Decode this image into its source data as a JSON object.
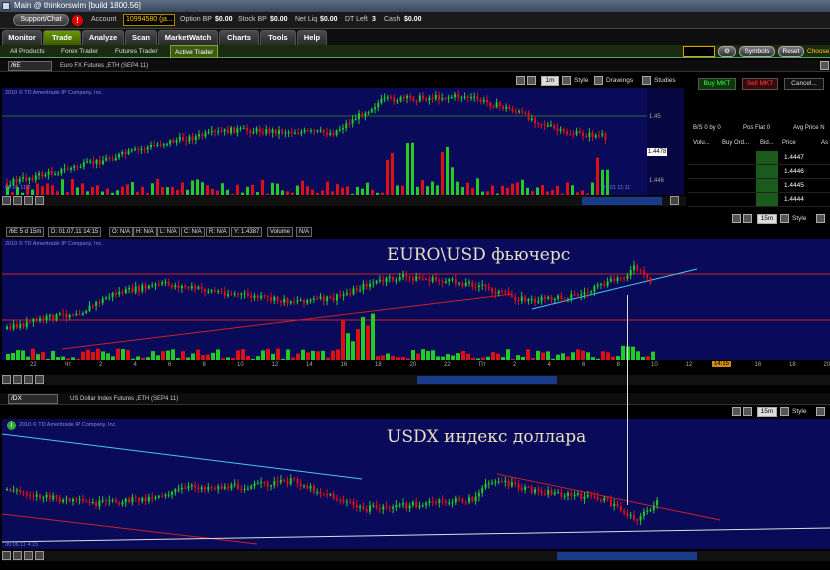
{
  "title_bar": {
    "title": "Main @ thinkorswim [build 1800.56]"
  },
  "account_bar": {
    "support_label": "Support/Chat",
    "alert_label": "!",
    "account_label": "Account",
    "account_value": "10994580 (ja...",
    "items": [
      {
        "label": "Option BP",
        "value": "$0.00"
      },
      {
        "label": "Stock BP",
        "value": "$0.00"
      },
      {
        "label": "Net Liq",
        "value": "$0.00"
      },
      {
        "label": "DT Left",
        "value": "3"
      },
      {
        "label": "Cash",
        "value": "$0.00"
      }
    ]
  },
  "main_tabs": [
    "Monitor",
    "Trade",
    "Analyze",
    "Scan",
    "MarketWatch",
    "Charts",
    "Tools",
    "Help"
  ],
  "active_main_tab": "Trade",
  "sub_tabs": [
    "All Products",
    "Forex Trader",
    "Futures Trader",
    "Active Trader"
  ],
  "active_sub_tab": "Active Trader",
  "sub_bar_buttons": {
    "symbols": "Symbols",
    "reset": "Reset",
    "choose": "Choose"
  },
  "panel1": {
    "symbol": "/6E",
    "description": "Euro FX Futures ,ETH (SEP4 11)",
    "timeframe": "1m",
    "style": "Style",
    "drawings": "Drawings",
    "studies": "Studies",
    "watermark": "2010 © TD Ameritrade IP Company, Inc.",
    "price_tag": "1.4478",
    "axis_labels": [
      "1.45",
      "1.446"
    ],
    "time_label": "07.01 11:11",
    "left_time_label": "07.01 11:0"
  },
  "order_panel": {
    "buy_label": "Buy MKT",
    "sell_label": "Sell MKT",
    "cancel_label": "Cancel...",
    "bs_label": "B/S 0 by 0",
    "pos_label": "Pos Flat 0",
    "avg_label": "Avg Price N",
    "headers": [
      "Volu...",
      "Buy Ord...",
      "Bid...",
      "Price",
      "As"
    ],
    "ladder": [
      {
        "price": "1.4447"
      },
      {
        "price": "1.4446"
      },
      {
        "price": "1.4445"
      },
      {
        "price": "1.4444"
      }
    ]
  },
  "panel2": {
    "timeframe": "15m",
    "style": "Style",
    "info": [
      "/6E 5 d 15m",
      "D: 01.07.11 14:15",
      "O: N/A",
      "H: N/A",
      "L: N/A",
      "C: N/A",
      "R: N/A",
      "Y: 1.4387",
      "Volume",
      "N/A"
    ],
    "watermark": "2010 © TD Ameritrade IP Company, Inc.",
    "overlay_text": "EURO\\USD фьючерс",
    "x_labels": [
      "22",
      "Чт",
      "2",
      "4",
      "6",
      "8",
      "10",
      "12",
      "14",
      "16",
      "18",
      "20",
      "22",
      "Пт",
      "2",
      "4",
      "6",
      "8",
      "10",
      "12",
      "14",
      "16",
      "18",
      "20"
    ],
    "x_highlight": "14:15"
  },
  "panel3": {
    "symbol": "/DX",
    "description": "US Dollar Index Futures ,ETH (SEP4 11)",
    "timeframe": "15m",
    "style": "Style",
    "watermark": "2010 © TD Ameritrade IP Company, Inc.",
    "overlay_text": "USDX индекс доллара",
    "bottom_label": "30.06.11 4:15",
    "info_icon": "i"
  },
  "colors": {
    "chart_bg": "#0a0a5a",
    "up_candle": "#22cc22",
    "down_candle": "#dd1111",
    "trend_cyan": "#44ccee",
    "trend_red": "#cc2222",
    "accent_green": "#6a9a00"
  }
}
